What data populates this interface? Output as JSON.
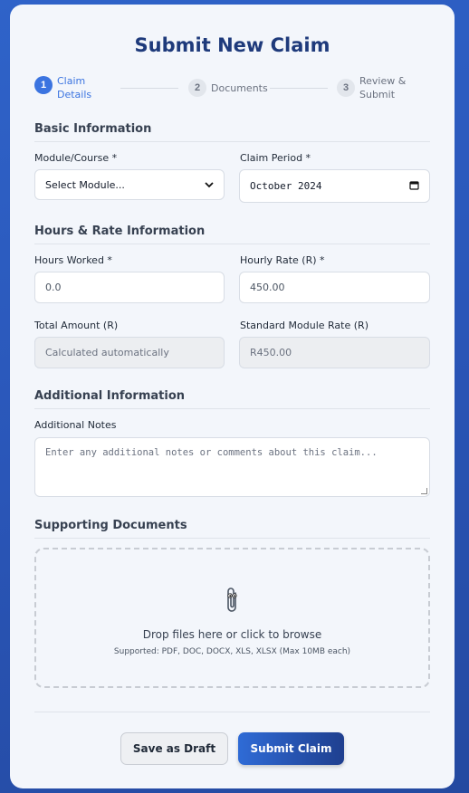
{
  "title": "Submit New Claim",
  "stepper": [
    {
      "number": "1",
      "label": "Claim Details"
    },
    {
      "number": "2",
      "label": "Documents"
    },
    {
      "number": "3",
      "label": "Review & Submit"
    }
  ],
  "basic": {
    "heading": "Basic Information",
    "module_label": "Module/Course *",
    "module_value": "Select Module...",
    "period_label": "Claim Period *",
    "period_value": "October 2024"
  },
  "hours": {
    "heading": "Hours & Rate Information",
    "hours_label": "Hours Worked *",
    "hours_value": "0.0",
    "rate_label": "Hourly Rate (R) *",
    "rate_value": "450.00",
    "total_label": "Total Amount (R)",
    "total_value": "Calculated automatically",
    "standard_label": "Standard Module Rate (R)",
    "standard_value": "R450.00"
  },
  "additional": {
    "heading": "Additional Information",
    "notes_label": "Additional Notes",
    "notes_placeholder": "Enter any additional notes or comments about this claim..."
  },
  "documents": {
    "heading": "Supporting Documents",
    "drop_text": "Drop files here or click to browse",
    "supported": "Supported: PDF, DOC, DOCX, XLS, XLSX (Max 10MB each)",
    "icon": "paperclip-icon"
  },
  "actions": {
    "draft_label": "Save as Draft",
    "submit_label": "Submit Claim"
  },
  "colors": {
    "accent": "#3b74e0",
    "title": "#1e3a7b",
    "background": "#2a56b8"
  }
}
